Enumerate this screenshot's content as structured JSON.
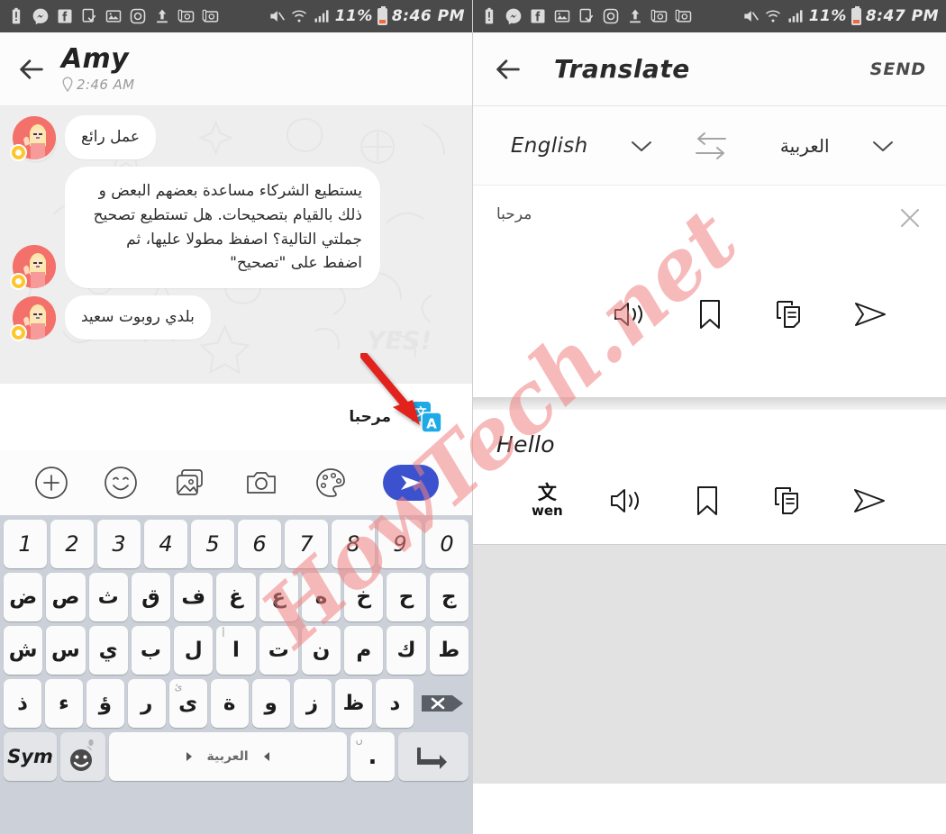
{
  "statusbar": {
    "left_icons": [
      "battery-alert-icon",
      "messenger-icon",
      "facebook-icon",
      "download-done-icon",
      "image-icon",
      "instagram-icon",
      "upload-icon",
      "screenshot-icon",
      "screenshot-icon-2"
    ],
    "right_icons": [
      "mute-icon",
      "wifi-icon",
      "signal-icon"
    ],
    "battery_percent_left": "11%",
    "battery_percent_right": "11%",
    "time_left": "8:46 PM",
    "time_right": "8:47 PM"
  },
  "chat": {
    "back_icon": "back-arrow-icon",
    "contact_name": "Amy",
    "last_seen": "2:46 AM",
    "last_seen_icon": "location-pin-icon",
    "messages": [
      {
        "text": "عمل رائع",
        "avatar": "amy-avatar"
      },
      {
        "text": "يستطيع الشركاء مساعدة بعضهم البعض و ذلك بالقيام بتصحيحات. هل تستطيع تصحيح جملتي التالية؟ اصفظ مطولا عليها، ثم اضفط على \"تصحيح\"",
        "avatar": "amy-avatar"
      },
      {
        "text": "بلدي روبوت سعيد",
        "avatar": "amy-avatar"
      }
    ]
  },
  "compose": {
    "typed_text": "مرحبا",
    "translate_badge_cjk": "文",
    "translate_badge_latin": "A",
    "translate_badge_color": "#1eaae6"
  },
  "toolbar": {
    "items": [
      "plus-circle-icon",
      "emoji-icon",
      "gallery-icon",
      "camera-icon",
      "palette-icon"
    ],
    "send_icon": "send-icon",
    "send_color": "#3b51cd"
  },
  "keyboard": {
    "row_numbers": [
      "1",
      "2",
      "3",
      "4",
      "5",
      "6",
      "7",
      "8",
      "9",
      "0"
    ],
    "row1": [
      "ض",
      "ص",
      "ث",
      "ق",
      "ف",
      "غ",
      "ع",
      "ه",
      "خ",
      "ح",
      "ج"
    ],
    "row2": [
      "ش",
      "س",
      "ي",
      "ب",
      "ل",
      "ا",
      "ت",
      "ن",
      "م",
      "ك",
      "ط"
    ],
    "row2_alt_index": 5,
    "row2_alt_label": "أ",
    "row3": [
      "ذ",
      "ء",
      "ؤ",
      "ر",
      "ى",
      "ة",
      "و",
      "ز",
      "ظ",
      "د"
    ],
    "row3_alt_index": 4,
    "row3_alt_label": "ئ",
    "backspace_icon": "backspace-icon",
    "sym_label": "Sym",
    "emoji_key_icon": "emoji-key-icon",
    "mic_icon": "microphone-icon",
    "space_label": "العربية",
    "space_left_icon": "arrow-left-icon",
    "space_right_icon": "arrow-right-icon",
    "dot_label": ".",
    "dot_alt_label": "ں",
    "enter_icon": "enter-icon"
  },
  "translate": {
    "back_icon": "back-arrow-icon",
    "title": "Translate",
    "send_label": "SEND",
    "source_language": "English",
    "target_language": "العربية",
    "source_chevron": "chevron-down-icon",
    "target_chevron": "chevron-down-icon",
    "swap_icon": "swap-horizontal-icon",
    "source_text": "مرحبا",
    "clear_icon": "close-icon",
    "result_text": "Hello",
    "actions_row1": [
      "speaker-icon",
      "bookmark-icon",
      "copy-icon",
      "send-icon"
    ],
    "actions_row2": [
      "transliterate-icon",
      "speaker-icon",
      "bookmark-icon",
      "copy-icon",
      "send-icon"
    ],
    "transliterate_cjk": "文",
    "transliterate_latin": "wen"
  },
  "annotation": {
    "arrow": "red-arrow-annotation"
  },
  "watermark": {
    "text": "HowTech.net",
    "color": "#f08282"
  }
}
